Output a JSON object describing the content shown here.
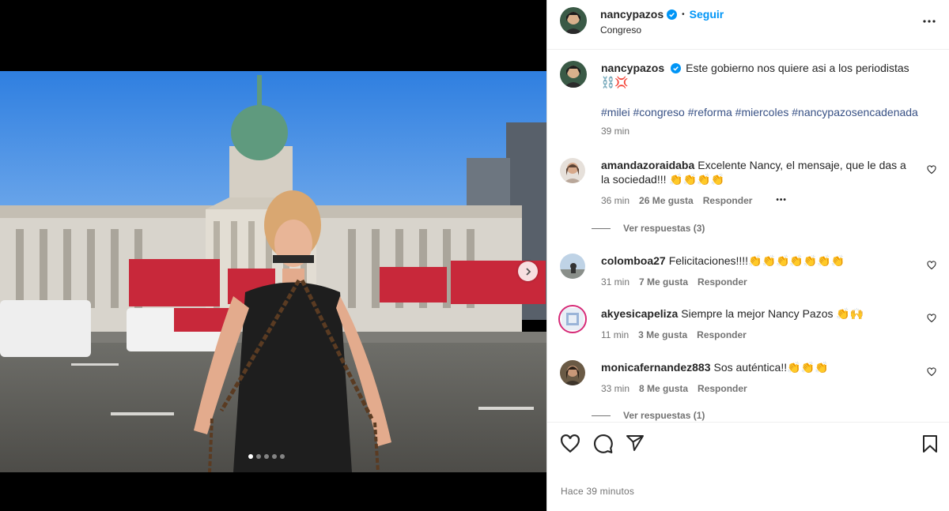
{
  "post": {
    "username": "nancypazos",
    "follow_label": "Seguir",
    "separator": "•",
    "location": "Congreso",
    "caption_text": "Este gobierno nos quiere asi a los periodistas",
    "caption_emojis": "⛓️💢",
    "hashtags": [
      "#milei",
      "#congreso",
      "#reforma",
      "#miercoles",
      "#nancypazosencadenada"
    ],
    "caption_time": "39 min",
    "time_ago": "Hace 39 minutos",
    "carousel": {
      "slide_count": 5,
      "active_index": 0
    }
  },
  "comments": [
    {
      "username": "amandazoraidaba",
      "text": "Excelente Nancy, el mensaje, que le das a la sociedad!!! 👏👏👏👏",
      "time": "36 min",
      "likes": "26 Me gusta",
      "reply_label": "Responder",
      "more_label": "•••",
      "view_replies": "Ver respuestas (3)"
    },
    {
      "username": "colomboa27",
      "text": "Felicitaciones!!!!👏👏👏👏👏👏👏",
      "time": "31 min",
      "likes": "7 Me gusta",
      "reply_label": "Responder"
    },
    {
      "username": "akyesicapeliza",
      "text": "Siempre la mejor Nancy Pazos 👏🙌",
      "time": "11 min",
      "likes": "3 Me gusta",
      "reply_label": "Responder"
    },
    {
      "username": "monicafernandez883",
      "text": "Sos auténtica!!👏👏👏",
      "time": "33 min",
      "likes": "8 Me gusta",
      "reply_label": "Responder",
      "view_replies": "Ver respuestas (1)"
    }
  ],
  "icons": {
    "like": "heart-icon",
    "comment": "comment-icon",
    "share": "paper-plane-icon",
    "save": "bookmark-icon",
    "more": "more-options-icon",
    "verified": "verified-badge-icon",
    "next": "chevron-right-icon"
  },
  "colors": {
    "link_blue": "#0095f6",
    "hashtag_blue": "#385185",
    "verified_blue": "#0095f6",
    "secondary_text": "#737373"
  }
}
